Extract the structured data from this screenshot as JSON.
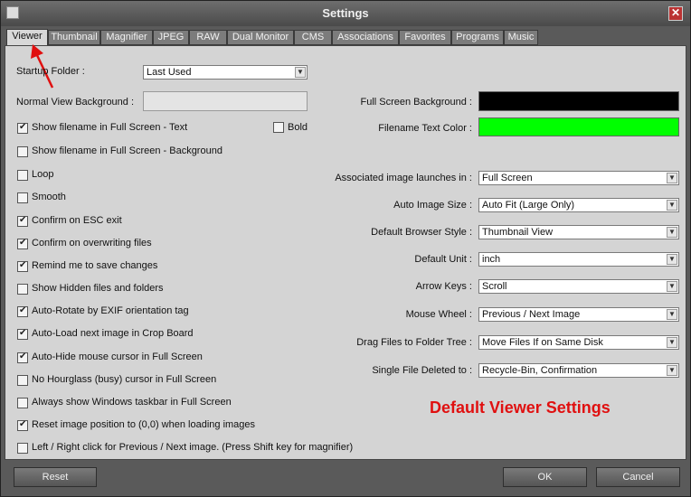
{
  "window": {
    "title": "Settings",
    "close_glyph": "✕",
    "sys_icon": "app-icon"
  },
  "tabs": [
    {
      "label": "Viewer",
      "active": true
    },
    {
      "label": "Thumbnail"
    },
    {
      "label": "Magnifier"
    },
    {
      "label": "JPEG"
    },
    {
      "label": "RAW"
    },
    {
      "label": "Dual Monitor"
    },
    {
      "label": "CMS"
    },
    {
      "label": "Associations"
    },
    {
      "label": "Favorites"
    },
    {
      "label": "Programs"
    },
    {
      "label": "Music"
    }
  ],
  "left": {
    "startup_folder_label": "Startup Folder :",
    "startup_folder_value": "Last Used",
    "normal_bg_label": "Normal View Background :",
    "bold_label": "Bold",
    "bold_checked": false,
    "checkboxes": [
      {
        "label": "Show filename in Full Screen - Text",
        "checked": true
      },
      {
        "label": "Show filename in Full Screen - Background",
        "checked": false
      },
      {
        "label": "Loop",
        "checked": false
      },
      {
        "label": "Smooth",
        "checked": false
      },
      {
        "label": "Confirm on ESC exit",
        "checked": true
      },
      {
        "label": "Confirm on overwriting files",
        "checked": true
      },
      {
        "label": "Remind me to save changes",
        "checked": true
      },
      {
        "label": "Show Hidden files and folders",
        "checked": false
      },
      {
        "label": "Auto-Rotate by EXIF orientation tag",
        "checked": true
      },
      {
        "label": "Auto-Load next image in Crop Board",
        "checked": true
      },
      {
        "label": "Auto-Hide mouse cursor in Full Screen",
        "checked": true
      },
      {
        "label": "No Hourglass (busy) cursor in Full Screen",
        "checked": false
      },
      {
        "label": "Always show Windows taskbar in Full Screen",
        "checked": false
      },
      {
        "label": "Reset image position to (0,0) when loading images",
        "checked": true
      },
      {
        "label": "Left / Right click for Previous / Next image. (Press Shift key for magnifier)",
        "checked": false
      }
    ]
  },
  "right": {
    "fullscreen_bg_label": "Full Screen Background :",
    "fullscreen_bg_color": "#000000",
    "filename_color_label": "Filename Text Color :",
    "filename_color": "#00ff00",
    "dropdowns": [
      {
        "label": "Associated image launches in :",
        "value": "Full Screen"
      },
      {
        "label": "Auto Image Size :",
        "value": "Auto Fit (Large Only)"
      },
      {
        "label": "Default Browser Style :",
        "value": "Thumbnail View"
      },
      {
        "label": "Default Unit :",
        "value": "inch"
      },
      {
        "label": "Arrow Keys :",
        "value": "Scroll"
      },
      {
        "label": "Mouse Wheel :",
        "value": "Previous / Next Image"
      },
      {
        "label": "Drag Files to Folder Tree :",
        "value": "Move Files If on Same Disk"
      },
      {
        "label": "Single File Deleted to :",
        "value": "Recycle-Bin, Confirmation"
      }
    ],
    "heading": "Default Viewer Settings",
    "heading_color": "#e01010"
  },
  "footer": {
    "reset_label": "Reset",
    "ok_label": "OK",
    "cancel_label": "Cancel"
  }
}
